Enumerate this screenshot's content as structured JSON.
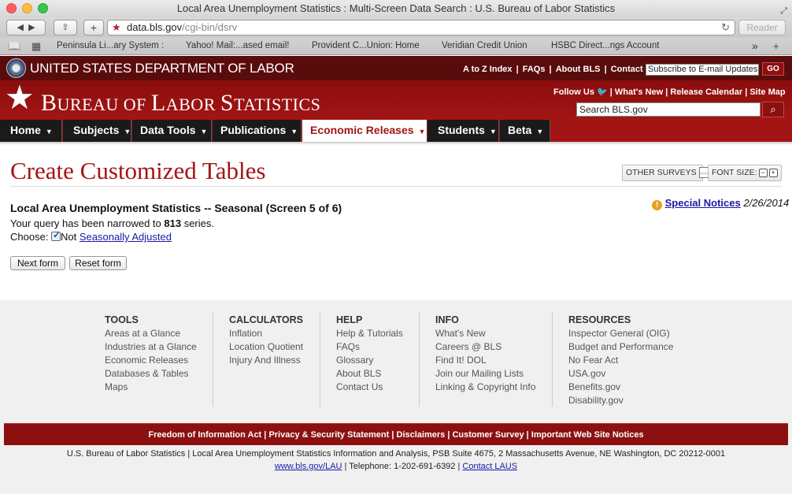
{
  "browser": {
    "window_title": "Local Area Unemployment Statistics : Multi-Screen Data Search : U.S. Bureau of Labor Statistics",
    "url_host": "data.bls.gov",
    "url_path": "/cgi-bin/dsrv",
    "reader_label": "Reader",
    "bookmarks": [
      "Peninsula Li...ary System :",
      "Yahoo! Mail:...ased email!",
      "Provident C...Union: Home",
      "Veridian Credit Union",
      "HSBC Direct...ngs Account"
    ],
    "overflow": "»"
  },
  "dol": {
    "title": "UNITED STATES DEPARTMENT OF LABOR",
    "links": [
      "A to Z Index",
      "FAQs",
      "About BLS",
      "Contact Us"
    ],
    "subscribe_placeholder": "Subscribe to E-mail Updates",
    "go_label": "GO"
  },
  "bls": {
    "title_big": "B",
    "title_rest1": "UREAU OF ",
    "title_big2": "L",
    "title_rest2": "ABOR ",
    "title_big3": "S",
    "title_rest3": "TATISTICS",
    "follow": "Follow Us",
    "links": [
      "What's New",
      "Release Calendar",
      "Site Map"
    ],
    "search_placeholder": "Search BLS.gov"
  },
  "nav": {
    "items": [
      "Home",
      "Subjects",
      "Data Tools",
      "Publications",
      "Economic Releases",
      "Students",
      "Beta"
    ],
    "active": "Economic Releases"
  },
  "main": {
    "title": "Create Customized Tables",
    "other_surveys": "OTHER SURVEYS",
    "font_size": "FONT SIZE:",
    "form_heading": "Local Area Unemployment Statistics -- Seasonal (Screen 5 of 6)",
    "notice_link": "Special Notices",
    "notice_date": "2/26/2014",
    "query_prefix": "Your query has been narrowed to ",
    "query_count": "813",
    "query_suffix": " series.",
    "choose_label": "Choose:",
    "choose_option_prefix": "Not ",
    "choose_option_link": "Seasonally Adjusted",
    "next_button": "Next form",
    "reset_button": "Reset form"
  },
  "footer": {
    "columns": [
      {
        "heading": "TOOLS",
        "items": [
          "Areas at a Glance",
          "Industries at a Glance",
          "Economic Releases",
          "Databases & Tables",
          "Maps"
        ]
      },
      {
        "heading": "CALCULATORS",
        "items": [
          "Inflation",
          "Location Quotient",
          "Injury And Illness"
        ]
      },
      {
        "heading": "HELP",
        "items": [
          "Help & Tutorials",
          "FAQs",
          "Glossary",
          "About BLS",
          "Contact Us"
        ]
      },
      {
        "heading": "INFO",
        "items": [
          "What's New",
          "Careers @ BLS",
          "Find It! DOL",
          "Join our Mailing Lists",
          "Linking & Copyright Info"
        ]
      },
      {
        "heading": "RESOURCES",
        "items": [
          "Inspector General (OIG)",
          "Budget and Performance",
          "No Fear Act",
          "USA.gov",
          "Benefits.gov",
          "Disability.gov"
        ]
      }
    ],
    "band_links": [
      "Freedom of Information Act",
      "Privacy & Security Statement",
      "Disclaimers",
      "Customer Survey",
      "Important Web Site Notices"
    ],
    "address": "U.S. Bureau of Labor Statistics | Local Area Unemployment Statistics Information and Analysis, PSB Suite 4675, 2 Massachusetts Avenue, NE Washington, DC 20212-0001",
    "contact_link1": "www.bls.gov/LAU",
    "contact_mid": " | Telephone: 1-202-691-6392 | ",
    "contact_link2": "Contact LAUS"
  }
}
